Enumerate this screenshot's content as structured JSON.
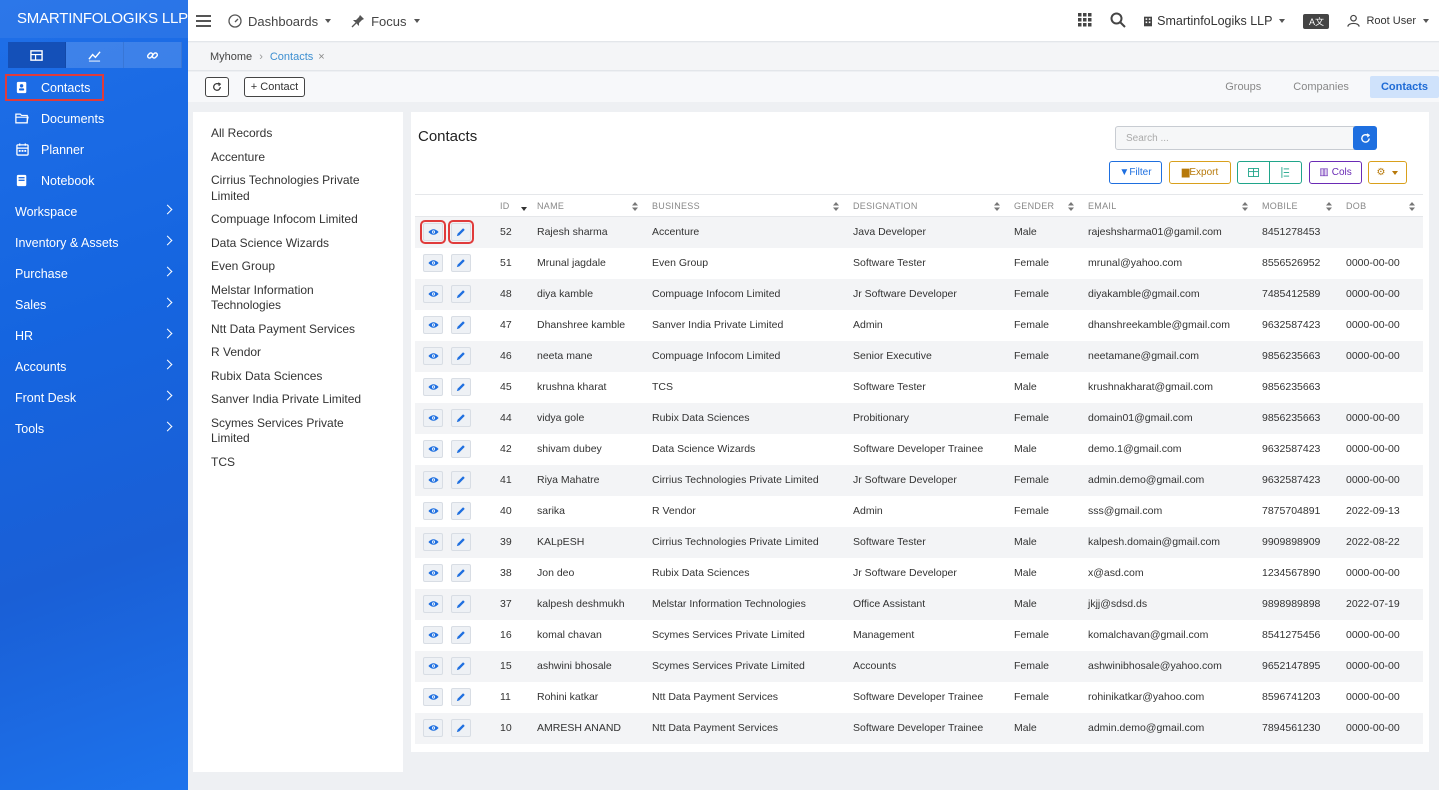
{
  "sidebar": {
    "brand": "SMARTINFOLOGIKS LLP",
    "tabs": [
      {
        "icon": "table-icon"
      },
      {
        "icon": "chart-icon"
      },
      {
        "icon": "link-icon"
      }
    ],
    "items": [
      {
        "label": "Contacts",
        "icon": "contact-card-icon",
        "selected": true
      },
      {
        "label": "Documents",
        "icon": "folder-icon"
      },
      {
        "label": "Planner",
        "icon": "calendar-icon"
      },
      {
        "label": "Notebook",
        "icon": "notebook-icon"
      }
    ],
    "groups": [
      "Workspace",
      "Inventory & Assets",
      "Purchase",
      "Sales",
      "HR",
      "Accounts",
      "Front Desk",
      "Tools"
    ]
  },
  "topbar": {
    "dashboards": "Dashboards",
    "focus": "Focus",
    "company": "SmartinfoLogiks LLP",
    "user": "Root User"
  },
  "breadcrumb": {
    "home": "Myhome",
    "current": "Contacts"
  },
  "actions": {
    "add_contact": "+ Contact"
  },
  "view_tabs": [
    "Groups",
    "Companies",
    "Contacts"
  ],
  "left_list": [
    "All Records",
    "Accenture",
    "Cirrius Technologies Private Limited",
    "Compuage Infocom Limited",
    "Data Science Wizards",
    "Even Group",
    "Melstar Information Technologies",
    "Ntt Data Payment Services",
    "R Vendor",
    "Rubix Data Sciences",
    "Sanver India Private Limited",
    "Scymes Services Private Limited",
    "TCS"
  ],
  "main": {
    "title": "Contacts",
    "search_placeholder": "Search ...",
    "filter": "Filter",
    "export": "Export",
    "cols": "Cols"
  },
  "columns": [
    "ID",
    "NAME",
    "BUSINESS",
    "DESIGNATION",
    "GENDER",
    "EMAIL",
    "MOBILE",
    "DOB"
  ],
  "rows": [
    [
      "52",
      "Rajesh sharma",
      "Accenture",
      "Java Developer",
      "Male",
      "rajeshsharma01@gamil.com",
      "8451278453",
      ""
    ],
    [
      "51",
      "Mrunal jagdale",
      "Even Group",
      "Software Tester",
      "Female",
      "mrunal@yahoo.com",
      "8556526952",
      "0000-00-00"
    ],
    [
      "48",
      "diya kamble",
      "Compuage Infocom Limited",
      "Jr Software Developer",
      "Female",
      "diyakamble@gmail.com",
      "7485412589",
      "0000-00-00"
    ],
    [
      "47",
      "Dhanshree kamble",
      "Sanver India Private Limited",
      "Admin",
      "Female",
      "dhanshreekamble@gmail.com",
      "9632587423",
      "0000-00-00"
    ],
    [
      "46",
      "neeta mane",
      "Compuage Infocom Limited",
      "Senior Executive",
      "Female",
      "neetamane@gmail.com",
      "9856235663",
      "0000-00-00"
    ],
    [
      "45",
      "krushna kharat",
      "TCS",
      "Software Tester",
      "Male",
      "krushnakharat@gmail.com",
      "9856235663",
      ""
    ],
    [
      "44",
      "vidya gole",
      "Rubix Data Sciences",
      "Probitionary",
      "Female",
      "domain01@gmail.com",
      "9856235663",
      "0000-00-00"
    ],
    [
      "42",
      "shivam dubey",
      "Data Science Wizards",
      "Software Developer Trainee",
      "Male",
      "demo.1@gmail.com",
      "9632587423",
      "0000-00-00"
    ],
    [
      "41",
      "Riya Mahatre",
      "Cirrius Technologies Private Limited",
      "Jr Software Developer",
      "Female",
      "admin.demo@gmail.com",
      "9632587423",
      "0000-00-00"
    ],
    [
      "40",
      "sarika",
      "R Vendor",
      "Admin",
      "Female",
      "sss@gmail.com",
      "7875704891",
      "2022-09-13"
    ],
    [
      "39",
      "KALpESH",
      "Cirrius Technologies Private Limited",
      "Software Tester",
      "Male",
      "kalpesh.domain@gmail.com",
      "9909898909",
      "2022-08-22"
    ],
    [
      "38",
      "Jon deo",
      "Rubix Data Sciences",
      "Jr Software Developer",
      "Male",
      "x@asd.com",
      "1234567890",
      "0000-00-00"
    ],
    [
      "37",
      "kalpesh deshmukh",
      "Melstar Information Technologies",
      "Office Assistant",
      "Male",
      "jkjj@sdsd.ds",
      "9898989898",
      "2022-07-19"
    ],
    [
      "16",
      "komal chavan",
      "Scymes Services Private Limited",
      "Management",
      "Female",
      "komalchavan@gmail.com",
      "8541275456",
      "0000-00-00"
    ],
    [
      "15",
      "ashwini bhosale",
      "Scymes Services Private Limited",
      "Accounts",
      "Female",
      "ashwinibhosale@yahoo.com",
      "9652147895",
      "0000-00-00"
    ],
    [
      "11",
      "Rohini katkar",
      "Ntt Data Payment Services",
      "Software Developer Trainee",
      "Female",
      "rohinikatkar@yahoo.com",
      "8596741203",
      "0000-00-00"
    ],
    [
      "10",
      "AMRESH ANAND",
      "Ntt Data Payment Services",
      "Software Developer Trainee",
      "Male",
      "admin.demo@gmail.com",
      "7894561230",
      "0000-00-00"
    ]
  ],
  "colors": {
    "accent": "#1e6fe0",
    "highlight": "#e03b3b",
    "sidebar": "#1565e0"
  }
}
